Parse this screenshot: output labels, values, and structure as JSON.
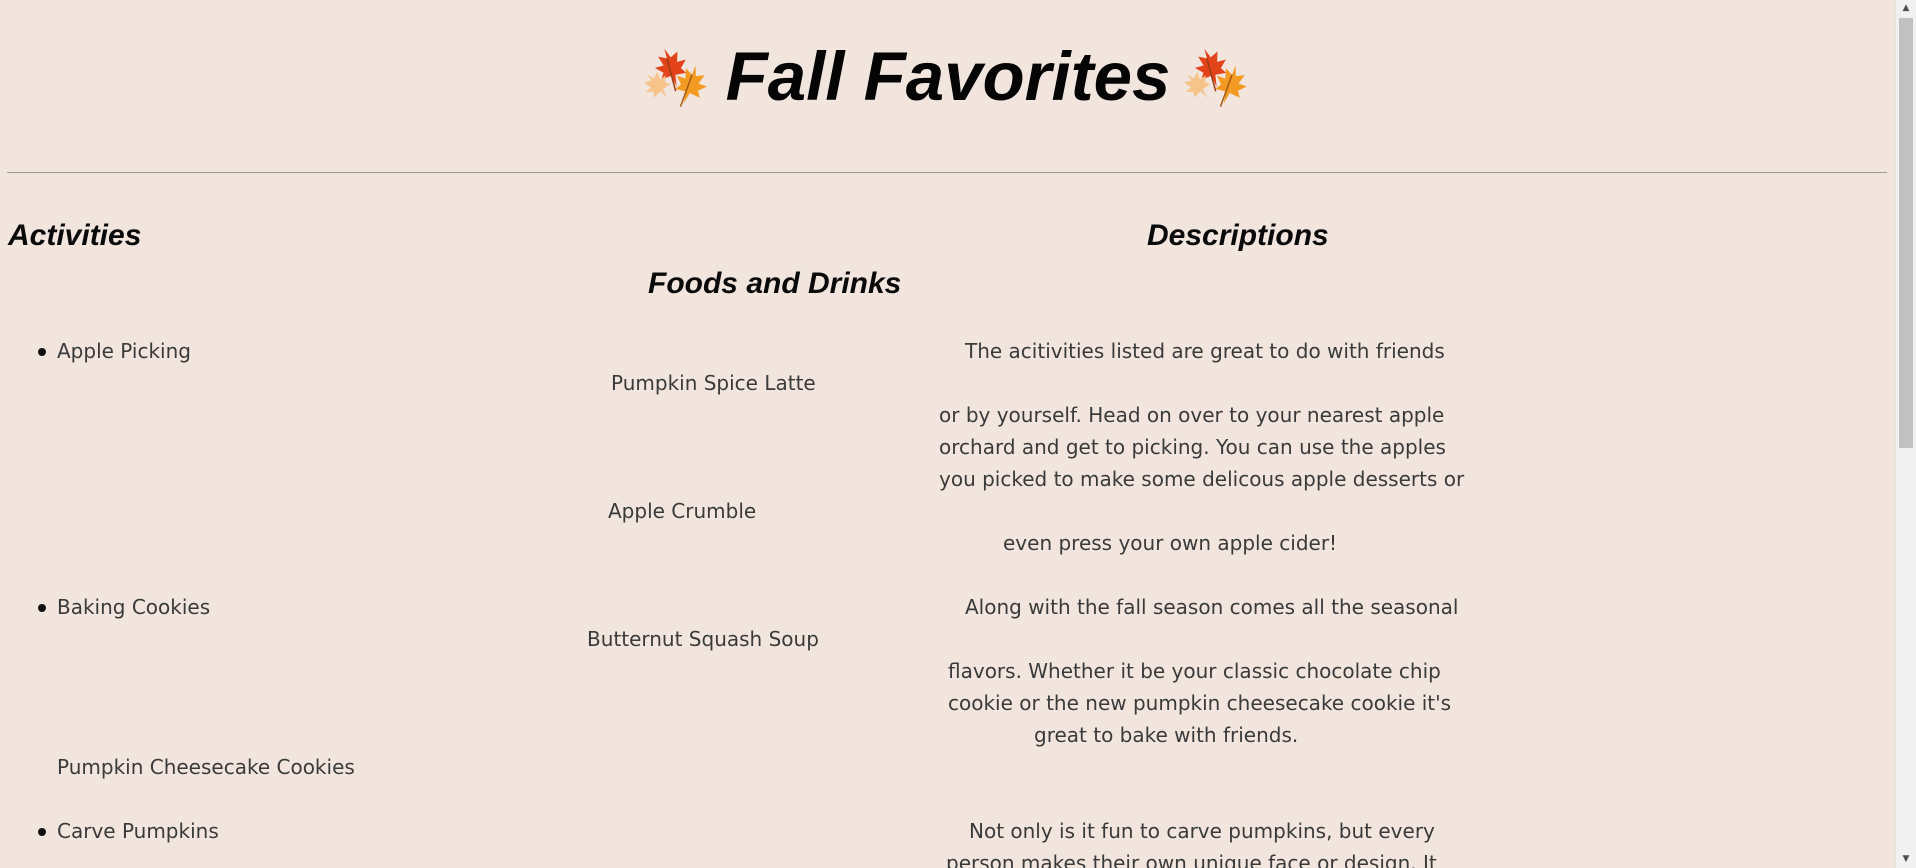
{
  "page": {
    "title": "Fall Favorites",
    "icons": [
      "maple-leaf-icon",
      "maple-leaf-icon"
    ]
  },
  "headings": {
    "activities": "Activities",
    "descriptions": "Descriptions",
    "foods": "Foods and Drinks"
  },
  "activities": [
    "Apple Picking",
    "Baking Cookies",
    "Carve Pumpkins"
  ],
  "foods": [
    "Pumpkin Spice Latte",
    "Apple Crumble",
    "Butternut Squash Soup",
    "Pumpkin Cheesecake Cookies"
  ],
  "descriptions": {
    "apple": [
      "The acitivities listed are great to do with friends",
      "or by yourself. Head on over to your nearest apple",
      "orchard and get to picking. You can use the apples",
      "you picked to make some delicous apple desserts or",
      "even press your own apple cider!"
    ],
    "cookies": [
      "Along with the fall season comes all the seasonal",
      "flavors. Whether it be your classic chocolate chip",
      "cookie or the new pumpkin cheesecake cookie it's",
      "great to bake with friends."
    ],
    "pumpkins": [
      "Not only is it fun to carve pumpkins, but every",
      "person makes their own unique face or design. It"
    ]
  },
  "colors": {
    "background": "#f1e5de",
    "text": "#3a3a3a",
    "heading": "#0a0a0a",
    "leaf_orange": "#f08a1c",
    "leaf_red": "#e0401a"
  }
}
